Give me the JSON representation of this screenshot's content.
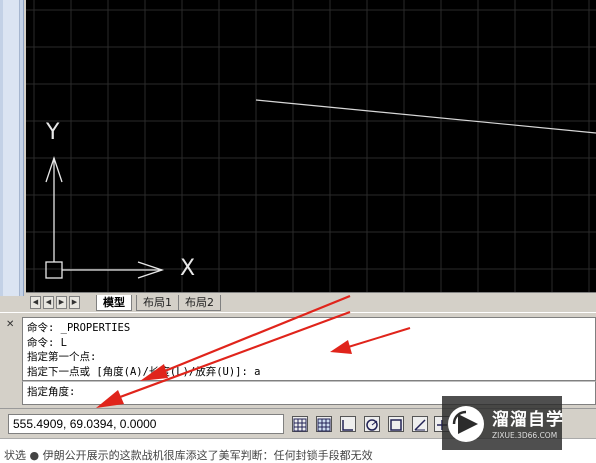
{
  "canvas": {
    "background": "#000000",
    "grid_color": "#2a2a2a",
    "line_color": "#d8d8d8",
    "ucs": {
      "y_label": "Y",
      "x_label": "X"
    }
  },
  "tabs": {
    "nav_first": "◀",
    "nav_prev": "◀",
    "nav_next": "▶",
    "nav_last": "▶",
    "items": [
      "模型",
      "布局1",
      "布局2"
    ],
    "active": "模型"
  },
  "command": {
    "close_glyph": "✕",
    "history": [
      "命令: _PROPERTIES",
      "命令: L",
      "指定第一个点:",
      "指定下一点或 [角度(A)/长度(L)/放弃(U)]: a"
    ],
    "prompt": "指定角度:"
  },
  "status": {
    "coordinates": "555.4909, 69.0394, 0.0000",
    "buttons": [
      "snap-grid-icon",
      "grid-display-icon",
      "ortho-icon",
      "polar-icon",
      "osnap-icon",
      "otrack-icon",
      "dyn-icon"
    ]
  },
  "bottom": {
    "text": "状选    ● 伊朗公开展示的这款战机很库添这了美军判断：任何封锁手段都无效"
  },
  "watermark": {
    "title": "溜溜自学",
    "url": "ZIXUE.3D66.COM"
  },
  "annotation": {
    "arrow_color": "#e0241b"
  }
}
